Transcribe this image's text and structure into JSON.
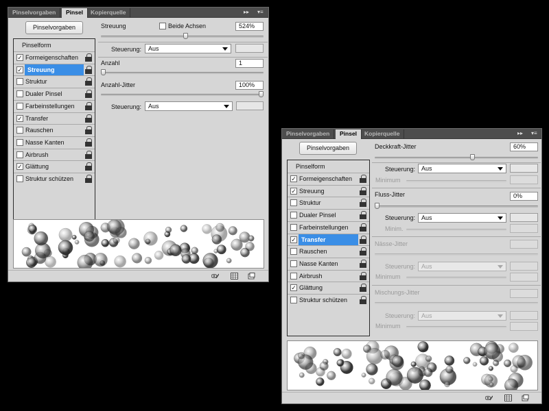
{
  "left_panel": {
    "tabs": [
      "Pinselvorgaben",
      "Pinsel",
      "Kopierquelle"
    ],
    "presets_button": "Pinselvorgaben",
    "list_header": "Pinselform",
    "items": [
      {
        "label": "Formeigenschaften",
        "checked": true
      },
      {
        "label": "Streuung",
        "checked": true,
        "selected": true
      },
      {
        "label": "Struktur",
        "checked": false
      },
      {
        "label": "Dualer Pinsel",
        "checked": false
      },
      {
        "label": "Farbeinstellungen",
        "checked": false
      },
      {
        "label": "Transfer",
        "checked": true
      },
      {
        "label": "Rauschen",
        "checked": false
      },
      {
        "label": "Nasse Kanten",
        "checked": false
      },
      {
        "label": "Airbrush",
        "checked": false
      },
      {
        "label": "Glättung",
        "checked": true
      },
      {
        "label": "Struktur schützen",
        "checked": false
      }
    ],
    "streuung_label": "Streuung",
    "beide_achsen_label": "Beide Achsen",
    "beide_achsen_checked": false,
    "streuung_value": "524%",
    "streuung_level": 0.52,
    "steuerung1_label": "Steuerung:",
    "steuerung1_value": "Aus",
    "anzahl_label": "Anzahl",
    "anzahl_value": "1",
    "anzahl_level": 0.0,
    "anzahl_jitter_label": "Anzahl-Jitter",
    "anzahl_jitter_value": "100%",
    "anzahl_jitter_level": 1.0,
    "steuerung2_label": "Steuerung:",
    "steuerung2_value": "Aus"
  },
  "right_panel": {
    "tabs": [
      "Pinselvorgaben",
      "Pinsel",
      "Kopierquelle"
    ],
    "presets_button": "Pinselvorgaben",
    "list_header": "Pinselform",
    "items": [
      {
        "label": "Formeigenschaften",
        "checked": true
      },
      {
        "label": "Streuung",
        "checked": true
      },
      {
        "label": "Struktur",
        "checked": false
      },
      {
        "label": "Dualer Pinsel",
        "checked": false
      },
      {
        "label": "Farbeinstellungen",
        "checked": false
      },
      {
        "label": "Transfer",
        "checked": true,
        "selected": true
      },
      {
        "label": "Rauschen",
        "checked": false
      },
      {
        "label": "Nasse Kanten",
        "checked": false
      },
      {
        "label": "Airbrush",
        "checked": false
      },
      {
        "label": "Glättung",
        "checked": true
      },
      {
        "label": "Struktur schützen",
        "checked": false
      }
    ],
    "deckkraft_label": "Deckkraft-Jitter",
    "deckkraft_value": "60%",
    "deckkraft_level": 0.6,
    "steuerung1_label": "Steuerung:",
    "steuerung1_value": "Aus",
    "minimum1_label": "Minimum",
    "fluss_label": "Fluss-Jitter",
    "fluss_value": "0%",
    "fluss_level": 0.0,
    "steuerung2_label": "Steuerung:",
    "steuerung2_value": "Aus",
    "minimum2_label": "Minim.",
    "naesse_label": "Nässe-Jitter",
    "steuerung3_label": "Steuerung:",
    "steuerung3_value": "Aus",
    "minimum3_label": "Minimum",
    "mischungs_label": "Mischungs-Jitter",
    "steuerung4_label": "Steuerung:",
    "steuerung4_value": "Aus",
    "minimum4_label": "Minimum"
  },
  "colors": {
    "panel_bg": "#d6d6d6",
    "tabbar_bg": "#4d4d4d",
    "selection": "#3a8ee6"
  },
  "icons": [
    "double-arrow-icon",
    "panel-menu-icon",
    "lock-icon",
    "eye-brush-icon",
    "grid-icon",
    "new-preset-icon"
  ]
}
